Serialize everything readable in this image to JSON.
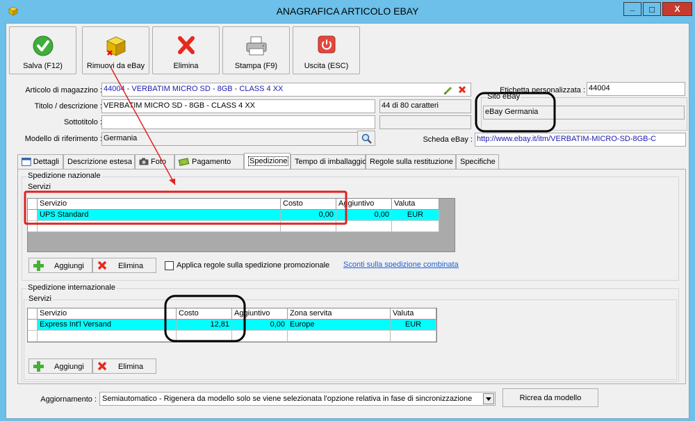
{
  "window": {
    "title": "ANAGRAFICA ARTICOLO EBAY",
    "minimize": "_",
    "maximize": "□",
    "close": "X"
  },
  "toolbar": {
    "save": "Salva (F12)",
    "remove_ebay": "Rimuovi da eBay",
    "delete": "Elimina",
    "print": "Stampa (F9)",
    "exit": "Uscita (ESC)"
  },
  "form": {
    "articolo_label": "Articolo di magazzino :",
    "articolo_value": "44004 - VERBATIM MICRO SD - 8GB - CLASS 4          XX",
    "etichetta_label": "Etichetta personalizzata :",
    "etichetta_value": "44004",
    "titolo_label": "Titolo / descrizione :",
    "titolo_value": "VERBATIM MICRO SD - 8GB - CLASS 4          XX",
    "char_count": "44 di 80 caratteri",
    "sottotitolo_label": "Sottotitolo :",
    "sottotitolo_value": "",
    "modello_label": "Modello di riferimento :",
    "modello_value": "Germania",
    "sito_label": "Sito eBay",
    "sito_value": "eBay Germania",
    "scheda_label": "Scheda eBay :",
    "scheda_value": "http://www.ebay.it/itm/VERBATIM-MICRO-SD-8GB-C"
  },
  "tabs": [
    {
      "label": "Dettagli"
    },
    {
      "label": "Descrizione estesa"
    },
    {
      "label": "Foto"
    },
    {
      "label": "Pagamento"
    },
    {
      "label": "Spedizione"
    },
    {
      "label": "Tempo di imballaggio"
    },
    {
      "label": "Regole sulla restituzione"
    },
    {
      "label": "Specifiche"
    }
  ],
  "nazionale": {
    "title": "Spedizione nazionale",
    "services_label": "Servizi",
    "headers": [
      "Servizio",
      "Costo",
      "Aggiuntivo",
      "Valuta"
    ],
    "rows": [
      {
        "servizio": "UPS Standard",
        "costo": "0,00",
        "aggiuntivo": "0,00",
        "valuta": "EUR"
      }
    ],
    "add": "Aggiungi",
    "delete": "Elimina",
    "promo_label": "Applica regole sulla spedizione promozionale",
    "link": "Sconti sulla spedizione combinata"
  },
  "internazionale": {
    "title": "Spedizione internazionale",
    "services_label": "Servizi",
    "headers": [
      "Servizio",
      "Costo",
      "Aggiuntivo",
      "Zona servita",
      "Valuta"
    ],
    "rows": [
      {
        "servizio": "Express Int'l Versand",
        "costo": "12,81",
        "aggiuntivo": "0,00",
        "zona": "Europe",
        "valuta": "EUR"
      }
    ],
    "add": "Aggiungi",
    "delete": "Elimina"
  },
  "footer": {
    "aggiornamento_label": "Aggiornamento :",
    "aggiornamento_value": "Semiautomatico - Rigenera da modello solo se viene selezionata l'opzione relativa in fase di sincronizzazione",
    "ricrea": "Ricrea da modello"
  },
  "colors": {
    "titlebar": "#6cc0ea",
    "selected_row": "#00ffff",
    "annotation_red": "#e02020",
    "annotation_black": "#000000",
    "link": "#1f5fd0"
  }
}
